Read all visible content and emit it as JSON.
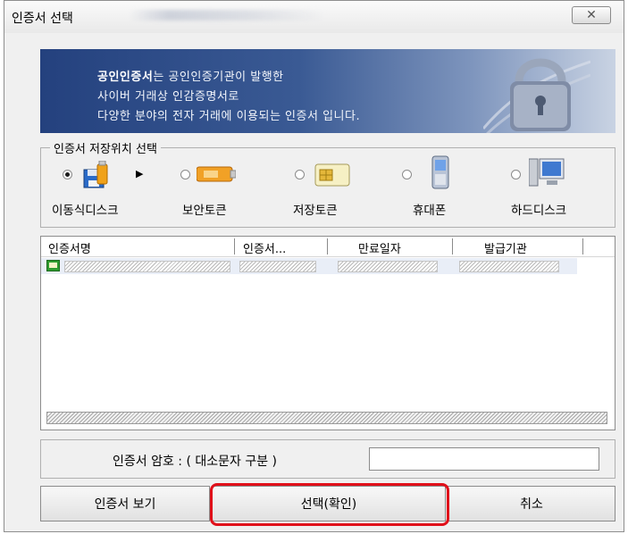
{
  "window": {
    "title": "인증서 선택",
    "close_label": "✕"
  },
  "banner": {
    "line1_bold": "공인인증서",
    "line1_rest": "는 공인인증기관이 발행한",
    "line2": "사이버 거래상 인감증명서로",
    "line3": "다양한 분야의 전자 거래에 이용되는 인증서 입니다."
  },
  "storage": {
    "group_label": "인증서 저장위치 선택",
    "selected": "removable-disk",
    "options": [
      {
        "id": "removable-disk",
        "label": "이동식디스크",
        "icon": "usb-floppy-icon"
      },
      {
        "id": "security-token",
        "label": "보안토큰",
        "icon": "security-token-icon"
      },
      {
        "id": "storage-token",
        "label": "저장토큰",
        "icon": "smart-card-icon"
      },
      {
        "id": "mobile-phone",
        "label": "휴대폰",
        "icon": "mobile-phone-icon"
      },
      {
        "id": "hard-disk",
        "label": "하드디스크",
        "icon": "computer-icon"
      }
    ]
  },
  "cert_list": {
    "columns": [
      "인증서명",
      "인증서...",
      "만료일자",
      "발급기관"
    ],
    "rows": [
      {
        "icon": "certificate-icon",
        "name": "",
        "type": "",
        "expiry": "",
        "issuer": ""
      }
    ]
  },
  "password": {
    "label": "인증서 암호 : ( 대소문자 구분 )",
    "value": ""
  },
  "buttons": {
    "view": "인증서 보기",
    "select": "선택(확인)",
    "cancel": "취소"
  },
  "colors": {
    "banner_dark": "#24417e",
    "highlight": "#e0101a",
    "selected_row": "#e9eef7"
  }
}
